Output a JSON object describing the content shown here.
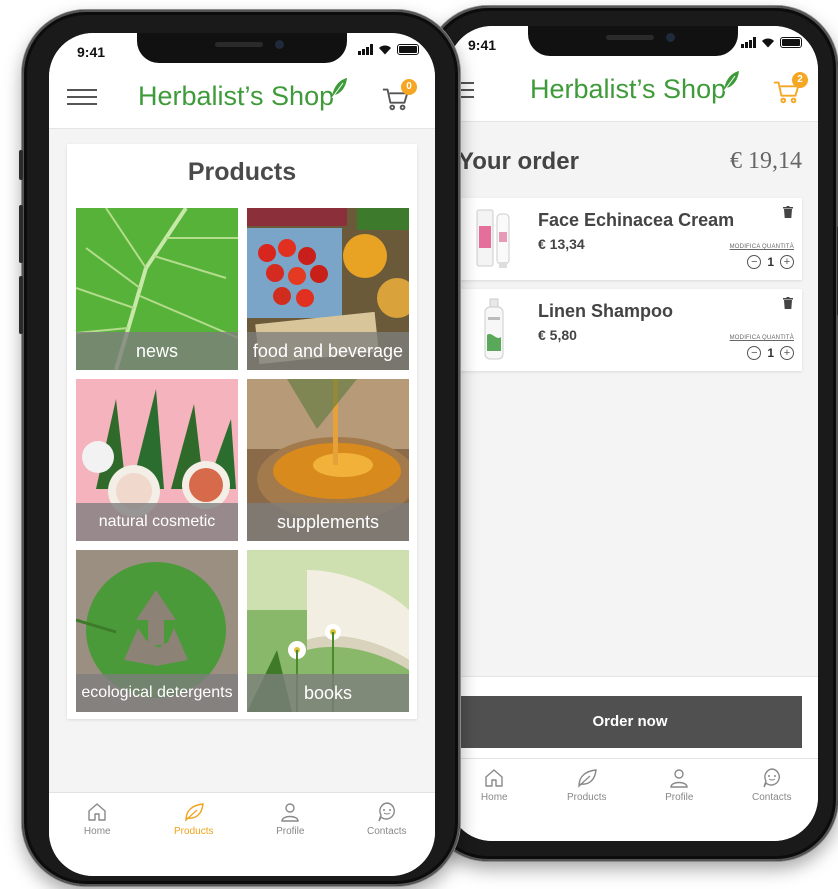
{
  "status": {
    "time": "9:41"
  },
  "products_screen": {
    "brand": "Herbalist’s Shop",
    "cart_count": "0",
    "title": "Products",
    "categories": [
      {
        "label": "news"
      },
      {
        "label": "food and beverage"
      },
      {
        "label": "natural cosmetic"
      },
      {
        "label": "supplements"
      },
      {
        "label": "ecological detergents"
      },
      {
        "label": "books"
      }
    ],
    "tabs": [
      {
        "label": "Home",
        "icon": "home-icon"
      },
      {
        "label": "Products",
        "icon": "leaf-icon"
      },
      {
        "label": "Profile",
        "icon": "user-icon"
      },
      {
        "label": "Contacts",
        "icon": "chat-icon"
      }
    ],
    "active_tab": "Products"
  },
  "order_screen": {
    "brand": "Herbalist’s Shop",
    "cart_count": "2",
    "title": "Your order",
    "total": "€ 19,14",
    "items": [
      {
        "name": "Face Echinacea Cream",
        "price": "€ 13,34",
        "qty_label": "MODIFICA QUANTITÀ",
        "qty": "1"
      },
      {
        "name": "Linen Shampoo",
        "price": "€ 5,80",
        "qty_label": "MODIFICA QUANTITÀ",
        "qty": "1"
      }
    ],
    "order_button": "Order now",
    "tabs": [
      {
        "label": "Home",
        "icon": "home-icon"
      },
      {
        "label": "Products",
        "icon": "leaf-icon"
      },
      {
        "label": "Profile",
        "icon": "user-icon"
      },
      {
        "label": "Contacts",
        "icon": "chat-icon"
      }
    ]
  },
  "colors": {
    "brand_green": "#3f9b3a",
    "accent_orange": "#f5a623",
    "dark_button": "#505050"
  }
}
